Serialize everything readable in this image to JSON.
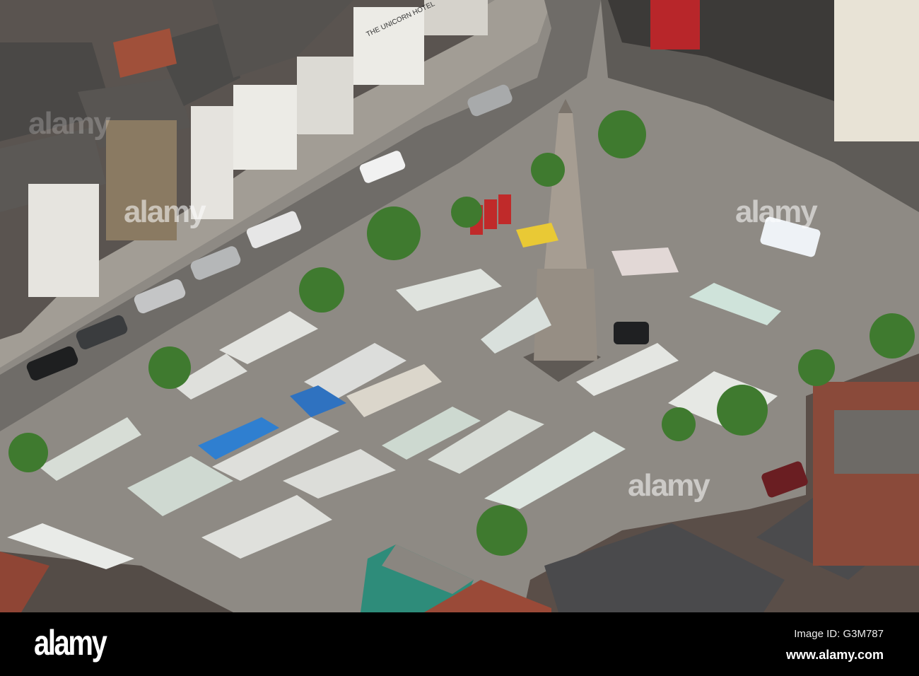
{
  "photo": {
    "watermark": "alamy",
    "shop_sign": "THE UNICORN HOTEL"
  },
  "footer": {
    "logo": "alamy",
    "image_id": "Image ID: G3M787",
    "url": "www.alamy.com"
  }
}
